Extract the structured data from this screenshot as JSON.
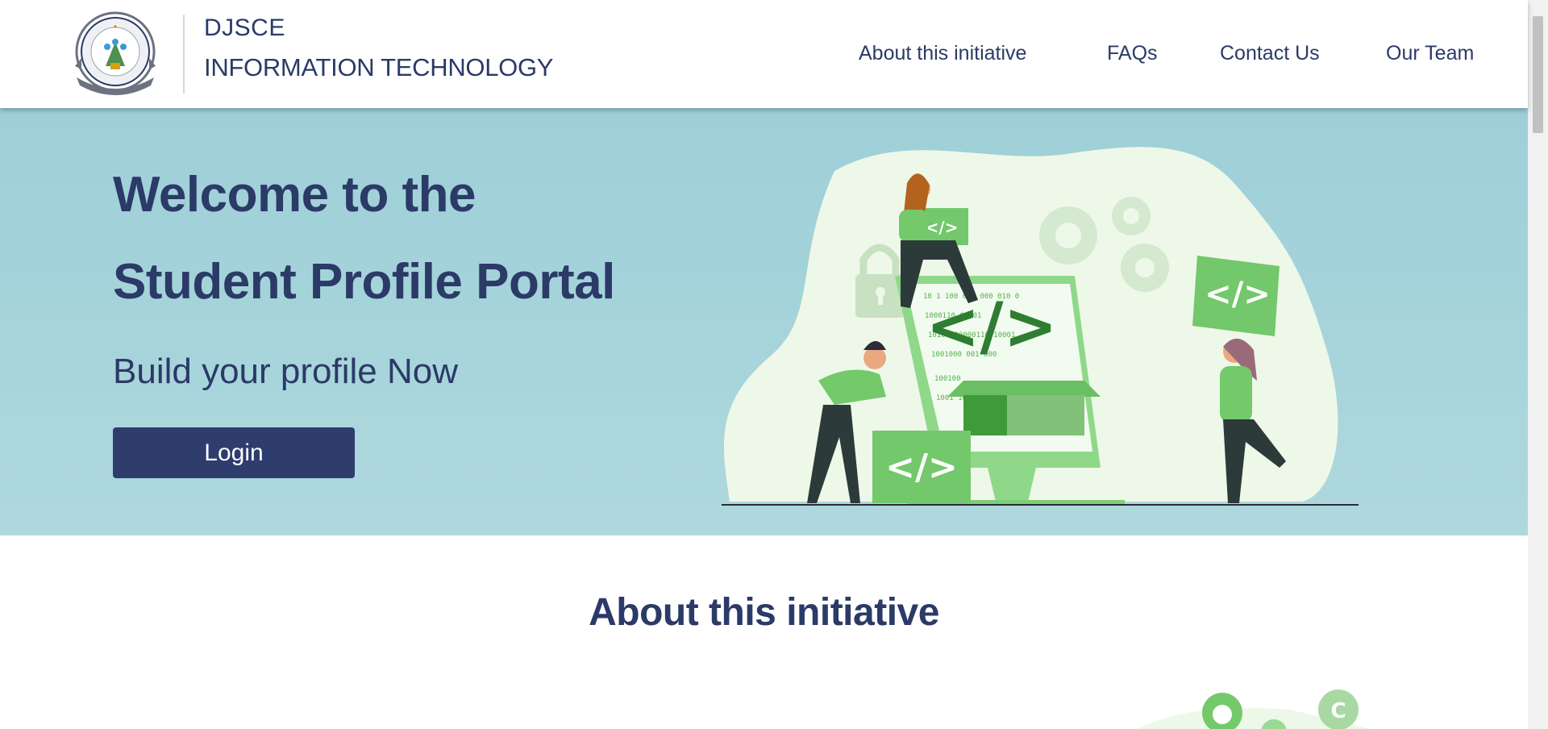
{
  "header": {
    "brand_top": "DJSCE",
    "brand_bottom": "INFORMATION TECHNOLOGY",
    "logo_icon": "college-crest-icon",
    "nav": [
      {
        "label": "About this initiative"
      },
      {
        "label": "FAQs"
      },
      {
        "label": "Contact Us"
      },
      {
        "label": "Our Team"
      }
    ]
  },
  "hero": {
    "title_line1": "Welcome to the",
    "title_line2": "Student Profile Portal",
    "subtitle": "Build your profile Now",
    "login_label": "Login",
    "illustration_icon": "developers-coding-illustration",
    "code_tag_text": "</>"
  },
  "about": {
    "title": "About this initiative",
    "icons": [
      "github-icon",
      "c-language-icon"
    ]
  },
  "colors": {
    "primary": "#2b3a67",
    "hero_bg": "#a5d3da",
    "accent_green": "#74c96b",
    "button_bg": "#2e3d6e"
  }
}
